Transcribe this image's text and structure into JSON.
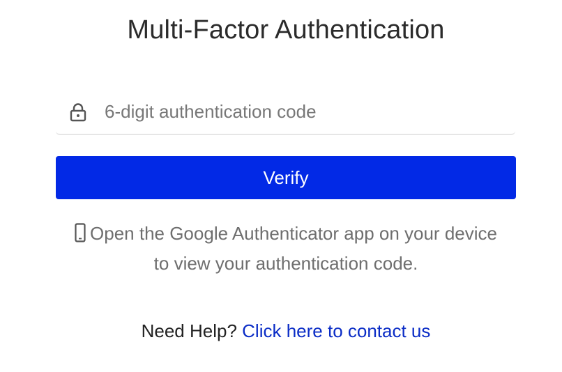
{
  "page": {
    "title": "Multi-Factor Authentication"
  },
  "code_field": {
    "placeholder": "6-digit authentication code",
    "value": "",
    "icon": "lock-icon"
  },
  "verify_button": {
    "label": "Verify",
    "color": "#0229e6"
  },
  "hint": {
    "icon": "smartphone-icon",
    "text": "Open the Google Authenticator app on your device to view your authentication code."
  },
  "help": {
    "prefix": "Need Help?",
    "link_text": "Click here to contact us",
    "link_color": "#0a2cc6"
  }
}
